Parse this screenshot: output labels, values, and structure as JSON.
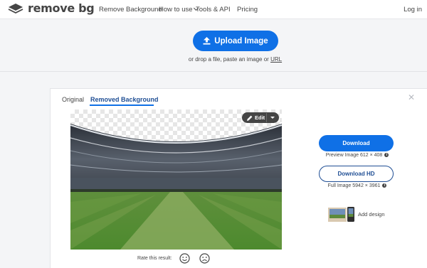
{
  "header": {
    "logo_text": "remove bg",
    "nav": {
      "remove_background": "Remove Background",
      "how_to_use": "How to use",
      "tools_api": "Tools & API",
      "pricing": "Pricing"
    },
    "login": "Log in"
  },
  "upload": {
    "button_label": "Upload Image",
    "hint_prefix": "or drop a file, paste an image or ",
    "hint_link": "URL"
  },
  "result": {
    "tabs": [
      {
        "label": "Original",
        "active": false
      },
      {
        "label": "Removed Background",
        "active": true
      }
    ],
    "edit_label": "Edit",
    "download_label": "Download",
    "preview_info": "Preview Image 612 × 408",
    "download_hd_label": "Download HD",
    "full_info": "Full Image 5942 × 3961",
    "add_design_label": "Add design",
    "rate_label": "Rate this result:",
    "icons": {
      "logo": "layers-logo-icon",
      "upload": "upload-arrow-icon",
      "edit": "pencil-icon",
      "info": "info-icon",
      "close": "close-icon",
      "happy": "happy-face-icon",
      "sad": "sad-face-icon"
    }
  },
  "colors": {
    "accent_blue": "#0f70e6",
    "dark_blue": "#1f4e94",
    "text": "#454545",
    "background": "#f4f5f7"
  }
}
